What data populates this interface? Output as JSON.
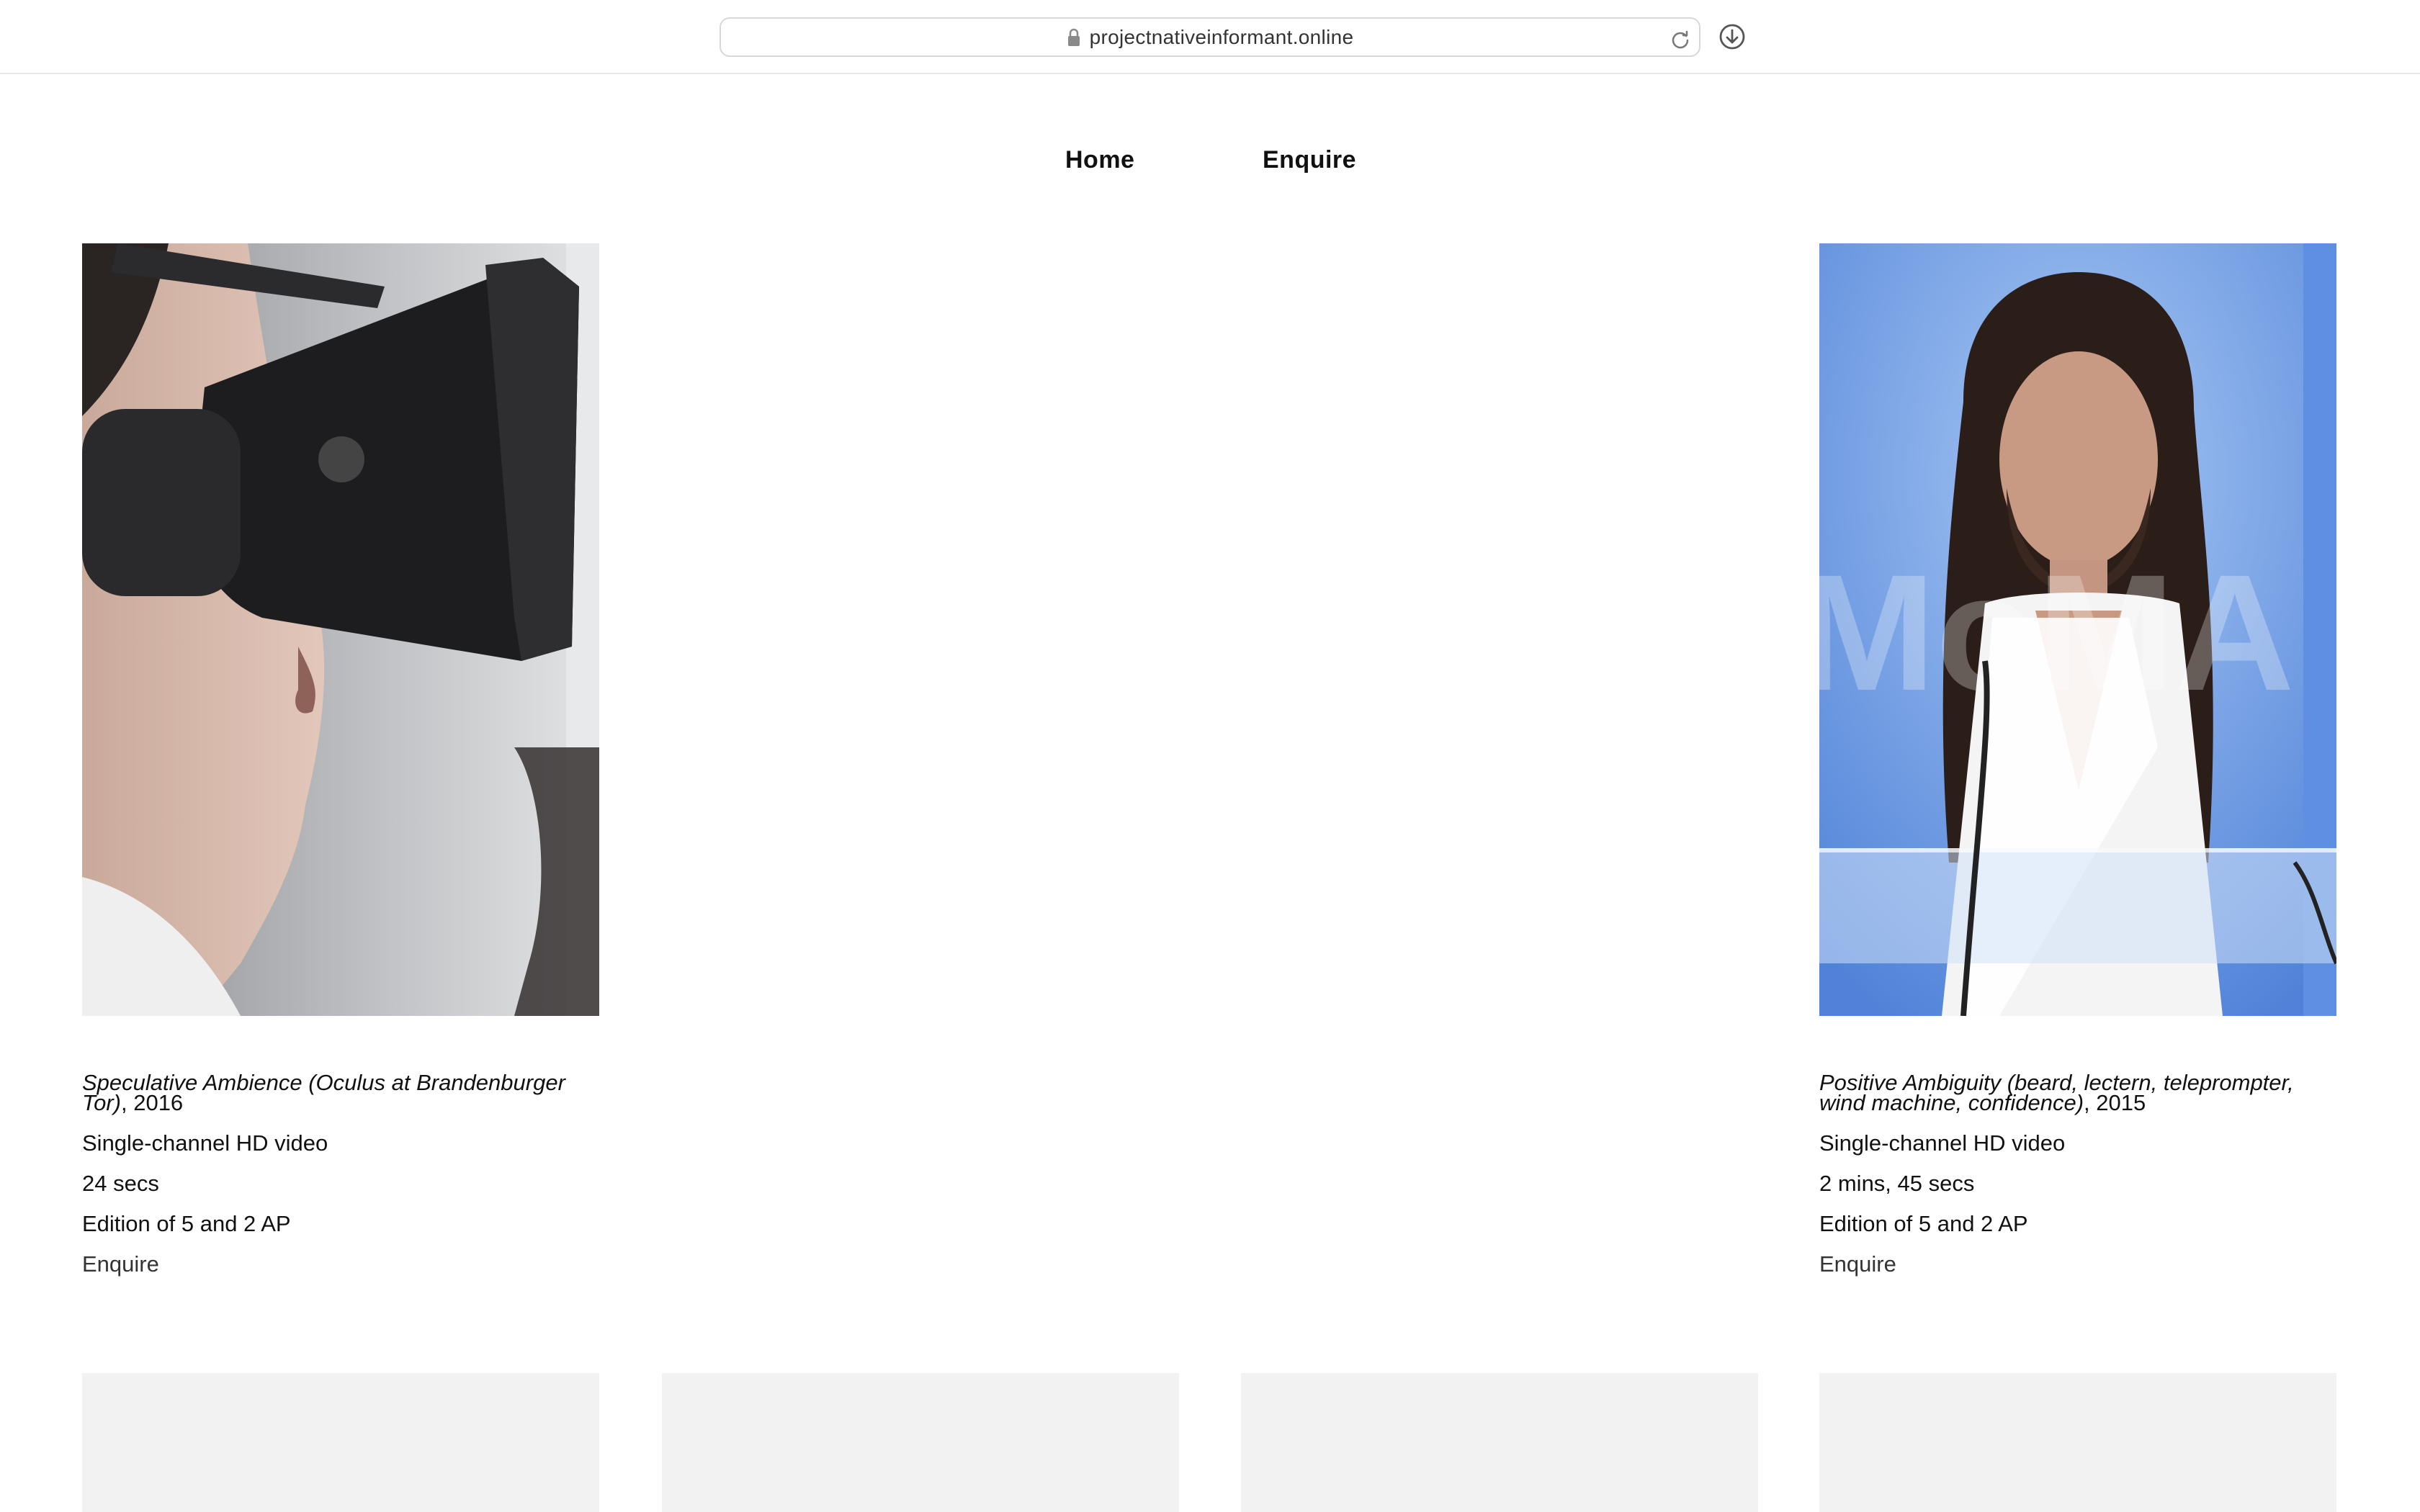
{
  "browser": {
    "url": "projectnativeinformant.online"
  },
  "nav": {
    "home_label": "Home",
    "enquire_label": "Enquire"
  },
  "works": [
    {
      "title": "Speculative Ambience (Oculus at Brandenburger Tor)",
      "year": ", 2016",
      "medium": "Single-channel HD video",
      "duration": "24 secs",
      "edition": "Edition of 5 and 2 AP",
      "enquire_label": "Enquire"
    },
    {
      "title": "Positive Ambiguity (beard, lectern, teleprompter, wind machine, confidence)",
      "year": ", 2015",
      "medium": "Single-channel HD video",
      "duration": "2 mins, 45 secs",
      "edition": "Edition of 5 and 2 AP",
      "enquire_label": "Enquire"
    }
  ],
  "colors": {
    "text": "#111111",
    "placeholder": "#f2f2f2",
    "right_image_bg": "#5b8ee0"
  }
}
